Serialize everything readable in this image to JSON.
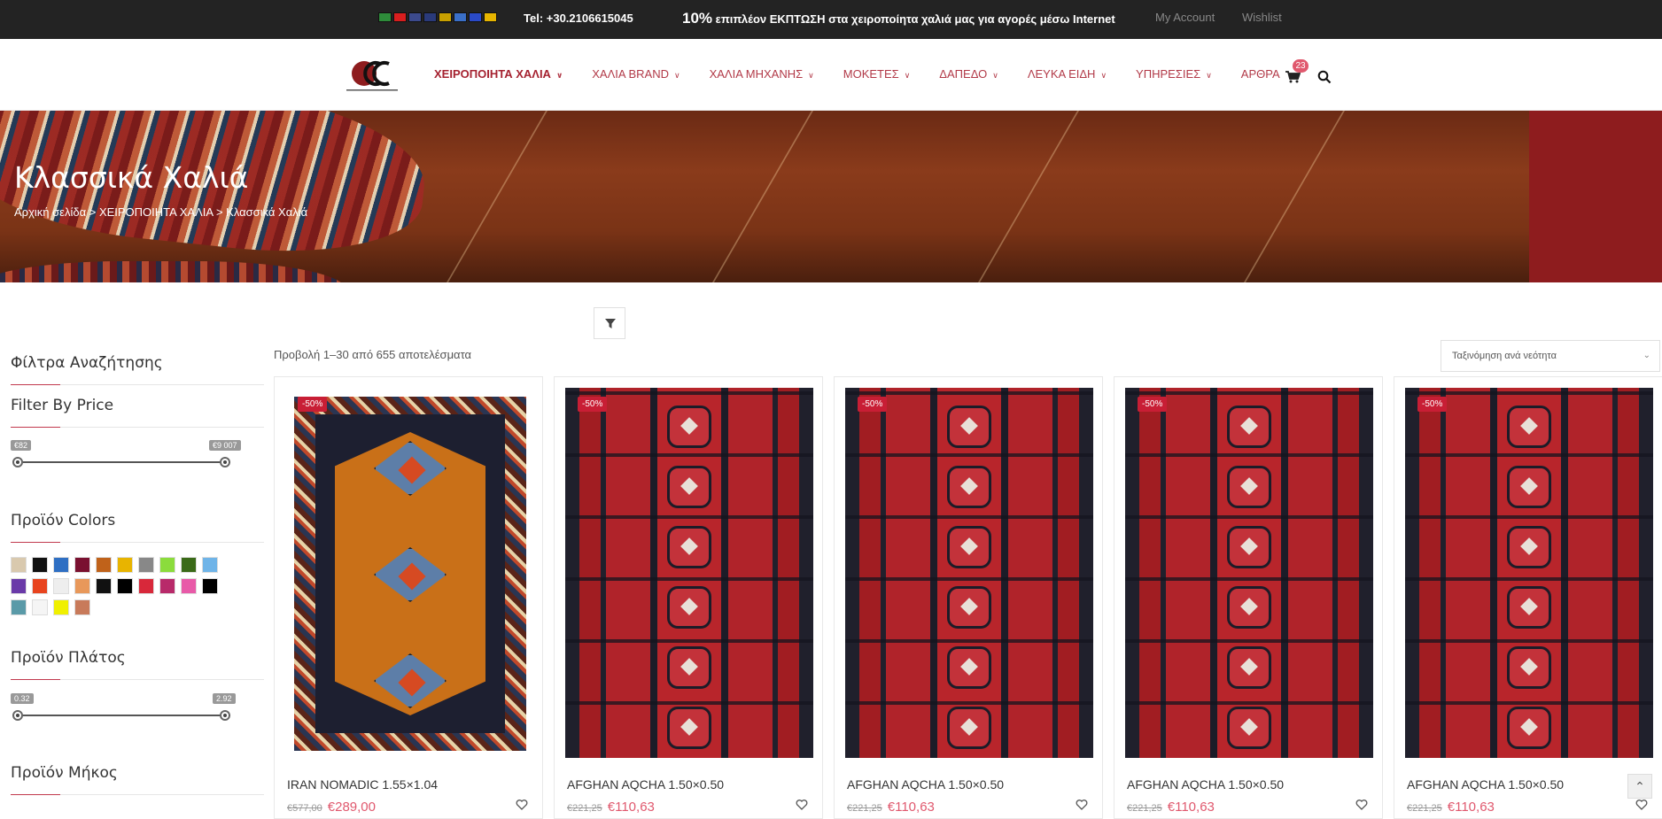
{
  "topbar": {
    "tel": "Tel: +30.2106615045",
    "promo_bold": "10%",
    "promo_text": " επιπλέον ΕΚΠΤΩΣΗ στα χειροποίητα χαλιά μας για αγορές μέσω Internet",
    "account": "My Account",
    "wishlist": "Wishlist",
    "flags": [
      {
        "name": "saudi-flag-icon",
        "color": "#2e8b3a"
      },
      {
        "name": "china-flag-icon",
        "color": "#d81e1e"
      },
      {
        "name": "usa-flag-icon",
        "color": "#3c4a8c"
      },
      {
        "name": "uk-flag-icon",
        "color": "#2a3a7a"
      },
      {
        "name": "germany-flag-icon",
        "color": "#c8a000"
      },
      {
        "name": "greece-flag-icon",
        "color": "#3a6fc8"
      },
      {
        "name": "russia-flag-icon",
        "color": "#2a4ac8"
      },
      {
        "name": "spain-flag-icon",
        "color": "#e6b400"
      }
    ]
  },
  "header": {
    "cart_count": "23",
    "nav": [
      {
        "label": "ΧΕΙΡΟΠΟΙΗΤΑ ΧΑΛΙΑ",
        "dropdown": true,
        "active": true
      },
      {
        "label": "ΧΑΛΙΑ BRAND",
        "dropdown": true
      },
      {
        "label": "ΧΑΛΙΑ ΜΗΧΑΝΗΣ",
        "dropdown": true
      },
      {
        "label": "ΜΟΚΕΤΕΣ",
        "dropdown": true
      },
      {
        "label": "ΔΑΠΕΔΟ",
        "dropdown": true
      },
      {
        "label": "ΛΕΥΚΑ ΕΙΔΗ",
        "dropdown": true
      },
      {
        "label": "ΥΠΗΡΕΣΙΕΣ",
        "dropdown": true
      },
      {
        "label": "ΑΡΘΡΑ",
        "dropdown": false
      }
    ]
  },
  "hero": {
    "title": "Κλασσικά Χαλιά",
    "crumbs": [
      "Αρχική σελίδα",
      "ΧΕΙΡΟΠΟΙΗΤΑ ΧΑΛΙΑ",
      "Κλασσικά Χαλιά"
    ],
    "separator": ">"
  },
  "sidebar": {
    "filters_title": "Φίλτρα Αναζήτησης",
    "price_title": "Filter By Price",
    "price_min": "€82",
    "price_max": "€9 007",
    "colors_title": "Προϊόν Colors",
    "colors": [
      "#d9c9ae",
      "#111111",
      "#2f6fc3",
      "#7a1030",
      "#c0621a",
      "#e8b400",
      "#888888",
      "#8bdc3c",
      "#3a6a18",
      "#6fb4e8",
      "#6a3aa8",
      "#e8441e",
      "#eeeeee",
      "#e8985a",
      "#111111",
      "#000000",
      "#d8283a",
      "#b82a6a",
      "#e85aa8",
      "#000000",
      "#5a9aa8",
      "#f5f5f5",
      "#f0f000",
      "#c87a5a"
    ],
    "width_title": "Προϊόν Πλάτος",
    "width_min": "0.32",
    "width_max": "2.92",
    "length_title": "Προϊόν Μήκος"
  },
  "results": {
    "count_text": "Προβολή 1–30 από 655 αποτελέσματα",
    "sort_label": "Ταξινόμηση ανά νεότητα"
  },
  "products": [
    {
      "badge": "-50%",
      "name": "IRAN NOMADIC 1.55×1.04",
      "old_price": "€577,00",
      "price": "€289,00",
      "style": "nomad"
    },
    {
      "badge": "-50%",
      "name": "AFGHAN AQCHA 1.50×0.50",
      "old_price": "€221,25",
      "price": "€110,63",
      "style": "red"
    },
    {
      "badge": "-50%",
      "name": "AFGHAN AQCHA 1.50×0.50",
      "old_price": "€221,25",
      "price": "€110,63",
      "style": "red"
    },
    {
      "badge": "-50%",
      "name": "AFGHAN AQCHA 1.50×0.50",
      "old_price": "€221,25",
      "price": "€110,63",
      "style": "red"
    },
    {
      "badge": "-50%",
      "name": "AFGHAN AQCHA 1.50×0.50",
      "old_price": "€221,25",
      "price": "€110,63",
      "style": "red"
    }
  ]
}
